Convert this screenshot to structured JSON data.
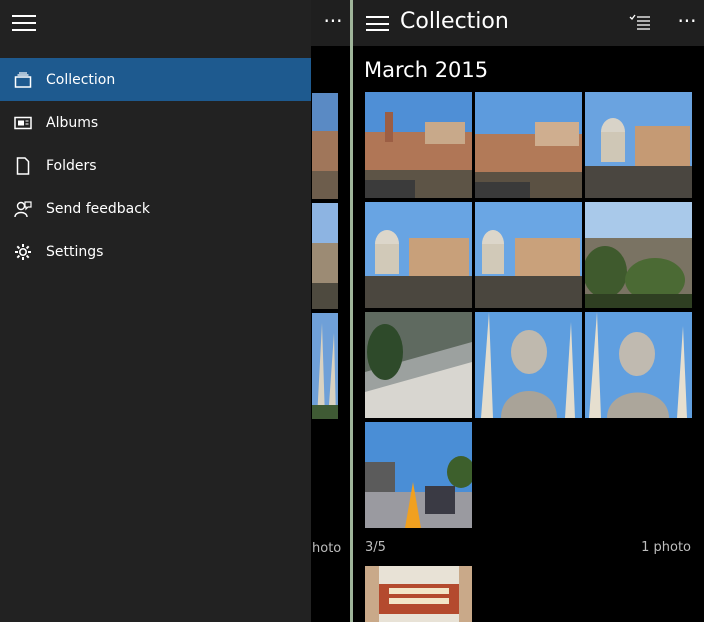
{
  "left": {
    "more_glyph": "···",
    "bg_footer": "hoto",
    "menu": [
      {
        "label": "Collection",
        "icon": "collection-icon",
        "active": true
      },
      {
        "label": "Albums",
        "icon": "albums-icon",
        "active": false
      },
      {
        "label": "Folders",
        "icon": "folders-icon",
        "active": false
      },
      {
        "label": "Send feedback",
        "icon": "feedback-icon",
        "active": false
      },
      {
        "label": "Settings",
        "icon": "gear-icon",
        "active": false
      }
    ]
  },
  "right": {
    "title": "Collection",
    "more_glyph": "···",
    "section": "March 2015",
    "counter": "3/5",
    "count": "1 photo",
    "photos": [
      "forum-ruins",
      "forum-ruins",
      "church-dome",
      "church-dome",
      "church-dome",
      "trees-panorama",
      "piazza-aerial",
      "bust-statue",
      "bust-statue",
      "crowd-street"
    ]
  },
  "colors": {
    "nav_bg": "#222222",
    "active_bg": "#1e5a8f",
    "divider": "#9fb59a",
    "header_bg": "#1f1f1f"
  }
}
